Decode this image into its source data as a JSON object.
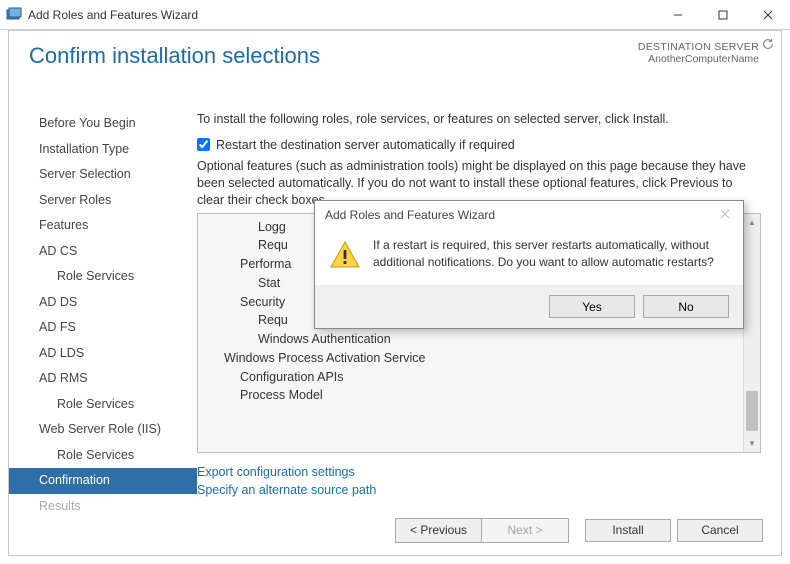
{
  "window": {
    "title": "Add Roles and Features Wizard"
  },
  "header": {
    "title": "Confirm installation selections",
    "destination_label": "DESTINATION SERVER",
    "destination_value": "AnotherComputerName"
  },
  "sidebar": {
    "items": [
      {
        "label": "Before You Begin",
        "selected": false
      },
      {
        "label": "Installation Type",
        "selected": false
      },
      {
        "label": "Server Selection",
        "selected": false
      },
      {
        "label": "Server Roles",
        "selected": false
      },
      {
        "label": "Features",
        "selected": false
      },
      {
        "label": "AD CS",
        "selected": false
      },
      {
        "label": "Role Services",
        "selected": false,
        "sub": true
      },
      {
        "label": "AD DS",
        "selected": false
      },
      {
        "label": "AD FS",
        "selected": false
      },
      {
        "label": "AD LDS",
        "selected": false
      },
      {
        "label": "AD RMS",
        "selected": false
      },
      {
        "label": "Role Services",
        "selected": false,
        "sub": true
      },
      {
        "label": "Web Server Role (IIS)",
        "selected": false
      },
      {
        "label": "Role Services",
        "selected": false,
        "sub": true
      },
      {
        "label": "Confirmation",
        "selected": true
      },
      {
        "label": "Results",
        "selected": false,
        "disabled": true
      }
    ]
  },
  "main": {
    "intro": "To install the following roles, role services, or features on selected server, click Install.",
    "restart_checkbox_label": "Restart the destination server automatically if required",
    "restart_checked": true,
    "optional_text": "Optional features (such as administration tools) might be displayed on this page because they have been selected automatically. If you do not want to install these optional features, click Previous to clear their check boxes.",
    "list_items": [
      {
        "text": "Logg",
        "level": 2
      },
      {
        "text": "Requ",
        "level": 2
      },
      {
        "text": "Performa",
        "level": 1
      },
      {
        "text": "Stat",
        "level": 2
      },
      {
        "text": "Security",
        "level": 1
      },
      {
        "text": "Requ",
        "level": 2
      },
      {
        "text": "Windows Authentication",
        "level": 2
      },
      {
        "text": "Windows Process Activation Service",
        "level": 0
      },
      {
        "text": "Configuration APIs",
        "level": 1
      },
      {
        "text": "Process Model",
        "level": 1
      }
    ],
    "link_export": "Export configuration settings",
    "link_alt": "Specify an alternate source path"
  },
  "footer": {
    "previous": "< Previous",
    "next": "Next >",
    "install": "Install",
    "cancel": "Cancel"
  },
  "dialog": {
    "title": "Add Roles and Features Wizard",
    "message": "If a restart is required, this server restarts automatically, without additional notifications. Do you want to allow automatic restarts?",
    "yes": "Yes",
    "no": "No"
  }
}
